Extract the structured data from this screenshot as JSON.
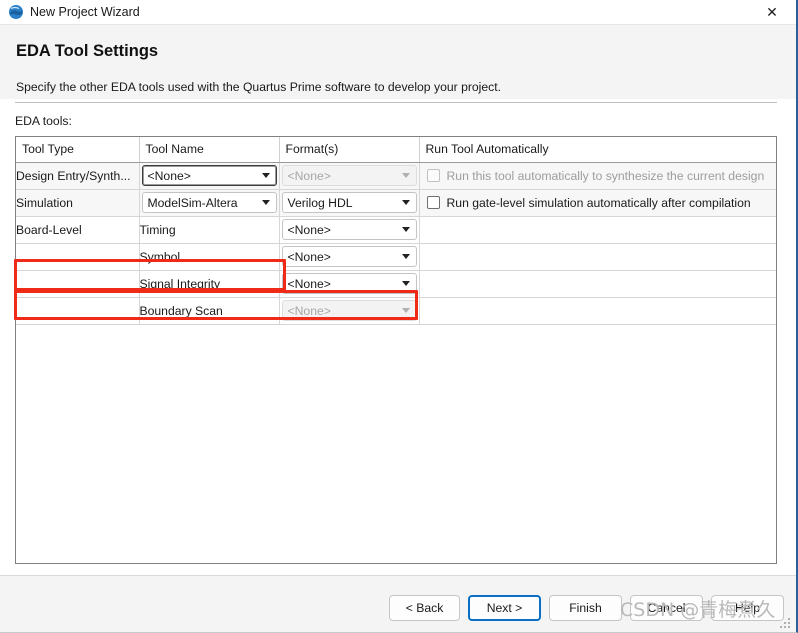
{
  "window": {
    "title": "New Project Wizard",
    "icon": "quartus-globe-icon",
    "close_label": "✕"
  },
  "header": {
    "title": "EDA Tool Settings",
    "description": "Specify the other EDA tools used with the Quartus Prime software to develop your project."
  },
  "main": {
    "section_label": "EDA tools:",
    "table": {
      "columns": [
        "Tool Type",
        "Tool Name",
        "Format(s)",
        "Run Tool Automatically"
      ],
      "rows": [
        {
          "tool_type": "Design Entry/Synth...",
          "tool_name": "<None>",
          "tool_name_disabled": false,
          "tool_name_focused": true,
          "format": "<None>",
          "format_disabled": true,
          "run_label": "Run this tool automatically to synthesize the current design",
          "run_checked": false,
          "run_disabled": true
        },
        {
          "tool_type": "Simulation",
          "tool_name": "ModelSim-Altera",
          "tool_name_disabled": false,
          "tool_name_focused": false,
          "format": "Verilog HDL",
          "format_disabled": false,
          "run_label": "Run gate-level simulation automatically after compilation",
          "run_checked": false,
          "run_disabled": false
        },
        {
          "tool_type": "Board-Level",
          "tool_name": "Timing",
          "tool_name_is_text": true,
          "format": "<None>",
          "format_disabled": false,
          "run_label": "",
          "run_checked": false,
          "run_disabled": false
        },
        {
          "tool_type": "",
          "tool_name": "Symbol",
          "tool_name_is_text": true,
          "format": "<None>",
          "format_disabled": false,
          "run_label": "",
          "run_checked": false,
          "run_disabled": false
        },
        {
          "tool_type": "",
          "tool_name": "Signal Integrity",
          "tool_name_is_text": true,
          "format": "<None>",
          "format_disabled": false,
          "run_label": "",
          "run_checked": false,
          "run_disabled": false
        },
        {
          "tool_type": "",
          "tool_name": "Boundary Scan",
          "tool_name_is_text": true,
          "format": "<None>",
          "format_disabled": true,
          "run_label": "",
          "run_checked": false,
          "run_disabled": false
        }
      ]
    }
  },
  "annotations": {
    "highlight_color": "#ef2b18",
    "boxes": [
      "design-entry-row-highlight",
      "simulation-row-highlight"
    ]
  },
  "footer": {
    "buttons": [
      {
        "id": "back",
        "label": "< Back",
        "primary": false
      },
      {
        "id": "next",
        "label": "Next >",
        "primary": true
      },
      {
        "id": "finish",
        "label": "Finish",
        "primary": false
      },
      {
        "id": "cancel",
        "label": "Cancel",
        "primary": false
      },
      {
        "id": "help",
        "label": "Help",
        "primary": false
      }
    ]
  },
  "watermark": {
    "text": "CSDN @青梅煮久"
  }
}
